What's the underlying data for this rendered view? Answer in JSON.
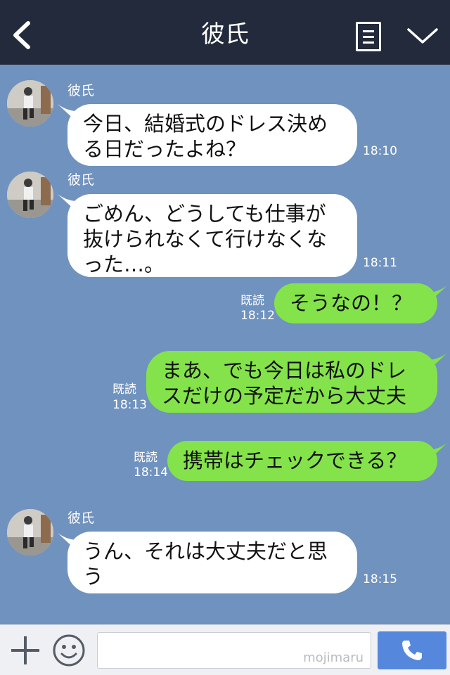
{
  "header": {
    "title": "彼氏"
  },
  "messages": [
    {
      "side": "in",
      "sender": "彼氏",
      "text": "今日、結婚式のドレス決め\nる日だったよね？",
      "time": "18:10"
    },
    {
      "side": "in",
      "sender": "彼氏",
      "text": "ごめん、どうしても仕事が\n抜けられなくて行けなくな\nった…。",
      "time": "18:11"
    },
    {
      "side": "out",
      "read": "既読",
      "text": "そうなの！？",
      "time": "18:12"
    },
    {
      "side": "out",
      "read": "既読",
      "text": "まあ、でも今日は私のドレ\nスだけの予定だから大丈夫",
      "time": "18:13"
    },
    {
      "side": "out",
      "read": "既読",
      "text": "携帯はチェックできる？",
      "time": "18:14"
    },
    {
      "side": "in",
      "sender": "彼氏",
      "text": "うん、それは大丈夫だと思\nう",
      "time": "18:15"
    }
  ],
  "input": {
    "placeholder": "",
    "watermark": "mojimaru"
  },
  "icons": {
    "back": "back-arrow-icon",
    "note": "note-icon",
    "menu": "chevron-down-icon",
    "add": "plus-icon",
    "emoji": "smile-icon",
    "call": "phone-icon"
  },
  "colors": {
    "header": "#222a3c",
    "background": "#7092be",
    "incoming_bubble": "#ffffff",
    "outgoing_bubble": "#84e34a",
    "call_button": "#5588dd"
  }
}
